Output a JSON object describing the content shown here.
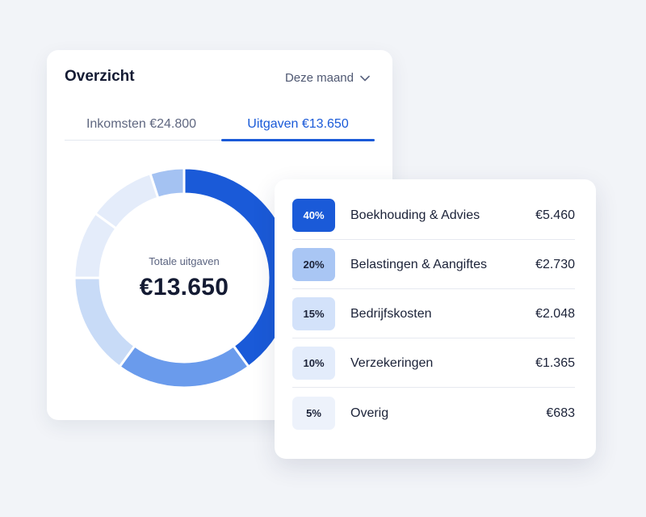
{
  "overview": {
    "title": "Overzicht",
    "period": "Deze maand",
    "tabs": [
      {
        "label": "Inkomsten €24.800",
        "active": false
      },
      {
        "label": "Uitgaven €13.650",
        "active": true
      }
    ],
    "donut": {
      "label": "Totale uitgaven",
      "total": "€13.650"
    }
  },
  "breakdown": {
    "items": [
      {
        "pct": "40%",
        "name": "Boekhouding & Advies",
        "amount": "€5.460",
        "fraction": 0.4,
        "color": "#1a5ad8",
        "pct_text_color": "#ffffff"
      },
      {
        "pct": "20%",
        "name": "Belastingen & Aangiftes",
        "amount": "€2.730",
        "fraction": 0.2,
        "color": "#a9c6f4",
        "pct_text_color": "#1b2238"
      },
      {
        "pct": "15%",
        "name": "Bedrijfskosten",
        "amount": "€2.048",
        "fraction": 0.15,
        "color": "#d3e2fa",
        "pct_text_color": "#1b2238"
      },
      {
        "pct": "10%",
        "name": "Verzekeringen",
        "amount": "€1.365",
        "fraction": 0.1,
        "color": "#e3ecfb",
        "pct_text_color": "#1b2238"
      },
      {
        "pct": "5%",
        "name": "Overig",
        "amount": "€683",
        "fraction": 0.05,
        "color": "#edf2fb",
        "pct_text_color": "#1b2238"
      }
    ]
  },
  "donut_segment_colors": [
    "#1a5ad8",
    "#6a9bec",
    "#c8dbf7",
    "#e4ecfa",
    "#e4ecfa",
    "#a4c2f2"
  ],
  "donut_segment_fractions": [
    0.4,
    0.2,
    0.15,
    0.1,
    0.1,
    0.05
  ]
}
